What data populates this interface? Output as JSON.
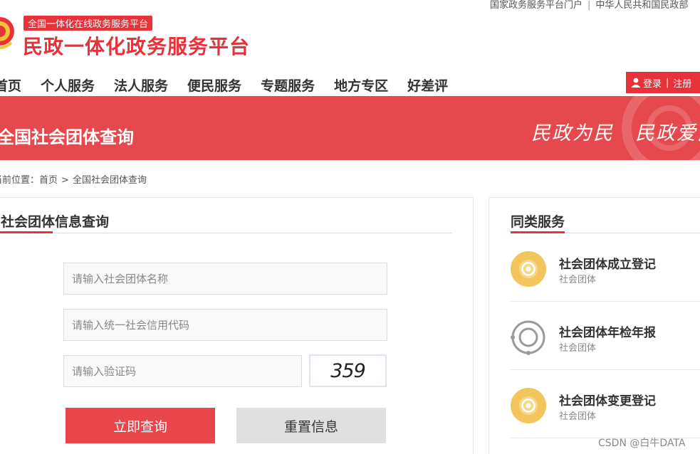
{
  "header": {
    "top_links": [
      "国家政务服务平台门户",
      "中华人民共和国民政部"
    ],
    "badge": "全国一体化在线政务服务平台",
    "site_title": "民政一体化政务服务平台"
  },
  "nav": {
    "items": [
      "首页",
      "个人服务",
      "法人服务",
      "便民服务",
      "专题服务",
      "地方专区",
      "好差评"
    ],
    "login": "登录",
    "register": "注册"
  },
  "banner": {
    "title": "全国社会团体查询",
    "slogan": [
      "民政为民",
      "民政爱民"
    ],
    "colors": {
      "accent": "#e8323a",
      "banner": "#e5484d"
    }
  },
  "breadcrumb": {
    "prefix": "当前位置：",
    "home": "首页",
    "separator": ">",
    "current": "全国社会团体查询"
  },
  "query_panel": {
    "heading": "社会团体信息查询",
    "name_placeholder": "请输入社会团体名称",
    "code_placeholder": "请输入统一社会信用代码",
    "captcha_placeholder": "请输入验证码",
    "captcha_value": "359",
    "query_button": "立即查询",
    "reset_button": "重置信息"
  },
  "related": {
    "heading": "同类服务",
    "items": [
      {
        "title": "社会团体成立登记",
        "category": "社会团体",
        "icon": "target-icon"
      },
      {
        "title": "社会团体年检年报",
        "category": "社会团体",
        "icon": "ring-icon"
      },
      {
        "title": "社会团体变更登记",
        "category": "社会团体",
        "icon": "target-icon"
      }
    ]
  },
  "watermark": "CSDN @白牛DATA"
}
